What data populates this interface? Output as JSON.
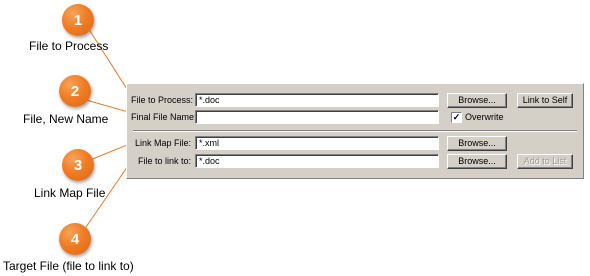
{
  "callouts": [
    {
      "number": "1",
      "label": "File to Process"
    },
    {
      "number": "2",
      "label": "File, New Name"
    },
    {
      "number": "3",
      "label": "Link Map File"
    },
    {
      "number": "4",
      "label": "Target File (file to link to)"
    }
  ],
  "panel": {
    "file_to_process": {
      "label": "File to Process:",
      "value": "*.doc",
      "browse": "Browse..."
    },
    "final_file_name": {
      "label": "Final File Name:",
      "value": ""
    },
    "overwrite": {
      "label": "Overwrite",
      "checked": true,
      "mark": "✓"
    },
    "link_to_self": "Link to Self",
    "link_map_file": {
      "label": "Link Map File:",
      "value": "*.xml",
      "browse": "Browse..."
    },
    "file_to_link_to": {
      "label": "File to link to:",
      "value": "*.doc",
      "browse": "Browse..."
    },
    "add_to_list": "Add to List"
  },
  "colors": {
    "callout_orange": "#f07d24",
    "dialog_face": "#d4d0c8"
  }
}
